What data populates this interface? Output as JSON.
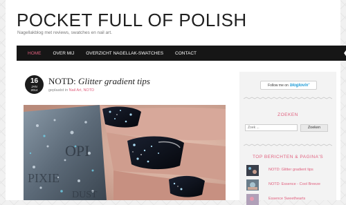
{
  "site": {
    "title": "POCKET FULL OF POLISH",
    "tagline": "Nagellakblog met reviews, swatches en nail art."
  },
  "nav": {
    "items": [
      {
        "label": "HOME",
        "active": true
      },
      {
        "label": "OVER MIJ",
        "active": false
      },
      {
        "label": "OVERZICHT NAGELLAK-SWATCHES",
        "active": false
      },
      {
        "label": "CONTACT",
        "active": false
      }
    ]
  },
  "post": {
    "date": {
      "day": "16",
      "month": "JAN",
      "year": "2014"
    },
    "title_prefix": "NOTD:",
    "title_rest": "Glitter gradient tips",
    "meta_prefix": "geplaatst in",
    "meta_category": "Nail Art, NOTD"
  },
  "sidebar": {
    "follow_label": "Follow me on",
    "follow_brand": "bloglovin'",
    "search_heading": "ZOEKEN",
    "search_placeholder": "Zoek ...",
    "search_button": "Zoeken",
    "top_heading": "TOP BERICHTEN & PAGINA'S",
    "top_items": [
      {
        "label": "NOTD: Glitter gradient tips"
      },
      {
        "label": "NOTD: Essence - Cool Breeze"
      },
      {
        "label": "Essence Sweethearts"
      }
    ]
  },
  "colors": {
    "accent": "#e0607e",
    "nav_bg": "#161616"
  }
}
